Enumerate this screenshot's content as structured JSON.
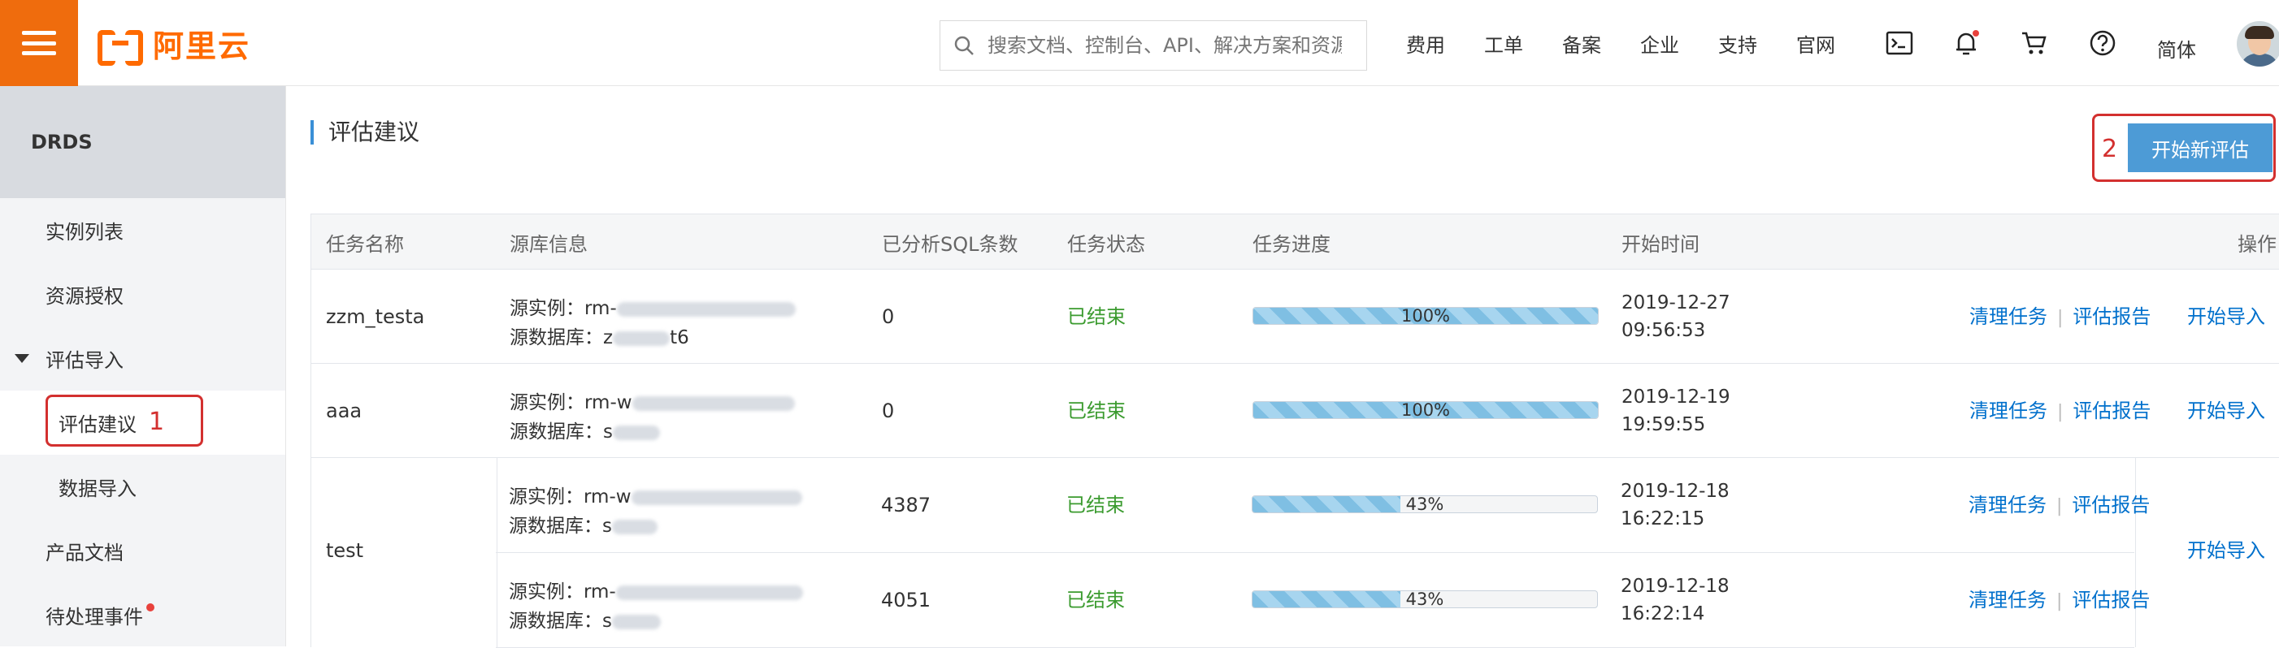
{
  "topbar": {
    "logo_text": "阿里云",
    "search_placeholder": "搜索文档、控制台、API、解决方案和资源",
    "nav": [
      "费用",
      "工单",
      "备案",
      "企业",
      "支持",
      "官网"
    ],
    "lang": "简体",
    "icons": {
      "terminal": "terminal-icon",
      "bell": "bell-icon",
      "cart": "cart-icon",
      "help": "help-icon"
    }
  },
  "sidebar": {
    "title": "DRDS",
    "items": [
      {
        "label": "实例列表"
      },
      {
        "label": "资源授权"
      },
      {
        "label": "评估导入"
      },
      {
        "label": "评估建议"
      },
      {
        "label": "数据导入"
      },
      {
        "label": "产品文档"
      },
      {
        "label": "待处理事件"
      }
    ],
    "annotation": "1"
  },
  "main": {
    "title": "评估建议",
    "new_button": "开始新评估",
    "annotation": "2",
    "columns": [
      "任务名称",
      "源库信息",
      "已分析SQL条数",
      "任务状态",
      "任务进度",
      "开始时间",
      "操作"
    ],
    "labels": {
      "src_instance": "源实例：",
      "src_db": "源数据库："
    },
    "actions": {
      "clean": "清理任务",
      "report": "评估报告",
      "import": "开始导入"
    },
    "rows": [
      {
        "name": "zzm_testa",
        "instance": "rm-",
        "db": "z",
        "db_tail": "t6",
        "sql_count": "0",
        "status": "已结束",
        "progress": 100,
        "progress_text": "100%",
        "date": "2019-12-27",
        "time": "09:56:53"
      },
      {
        "name": "aaa",
        "instance": "rm-w",
        "db": "s",
        "db_tail": "",
        "sql_count": "0",
        "status": "已结束",
        "progress": 100,
        "progress_text": "100%",
        "date": "2019-12-19",
        "time": "19:59:55"
      },
      {
        "name": "test",
        "instance": "rm-w",
        "db": "s",
        "db_tail": "",
        "sql_count": "4387",
        "status": "已结束",
        "progress": 43,
        "progress_text": "43%",
        "date": "2019-12-18",
        "time": "16:22:15"
      },
      {
        "name": "",
        "instance": "rm-",
        "db": "s",
        "db_tail": "",
        "sql_count": "4051",
        "status": "已结束",
        "progress": 43,
        "progress_text": "43%",
        "date": "2019-12-18",
        "time": "16:22:14"
      }
    ]
  },
  "colors": {
    "accent": "#ff6a00",
    "link": "#0070cc",
    "button": "#4d9bd6",
    "status": "#3b9b2f",
    "annotation": "#d3302f"
  }
}
